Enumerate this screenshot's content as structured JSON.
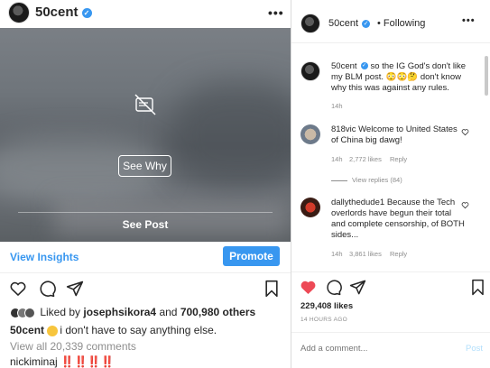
{
  "post": {
    "username": "50cent",
    "media": {
      "see_why_label": "See Why",
      "see_post_label": "See Post"
    },
    "view_insights_label": "View Insights",
    "promote_label": "Promote",
    "liked_prefix": "Liked by",
    "liked_user": "josephsikora4",
    "liked_and": "and",
    "liked_others": "700,980 others",
    "caption_user": "50cent",
    "caption_text": "i don't have to say anything else.",
    "view_all_comments": "View all 20,339 comments",
    "last_comment_user": "nickiminaj",
    "last_comment_text": "‼️‼️‼️‼️"
  },
  "detail": {
    "username": "50cent",
    "following_label": "• Following",
    "caption": {
      "user": "50cent",
      "text": "so the IG God's don't like my BLM post. 😳😳🤔 don't know why this was against any rules.",
      "time": "14h"
    },
    "comments": [
      {
        "user": "818vic",
        "text": "Welcome to United States of China big dawg!",
        "time": "14h",
        "likes": "2,772 likes",
        "reply_label": "Reply",
        "view_replies": "View replies (84)"
      },
      {
        "user": "dallythedude1",
        "text": "Because the Tech overlords have begun their total and complete censorship, of BOTH sides...",
        "time": "14h",
        "likes": "3,861 likes",
        "reply_label": "Reply"
      }
    ],
    "likes_count": "229,408 likes",
    "timestamp": "14 HOURS AGO",
    "add_comment_placeholder": "Add a comment...",
    "post_label": "Post"
  },
  "icons": {
    "hidden": "eye-slash-icon",
    "like": "heart-icon",
    "comment": "comment-icon",
    "share": "share-icon",
    "save": "bookmark-icon",
    "more": "more-icon",
    "verified": "verified-badge-icon"
  },
  "colors": {
    "link_blue": "#3897f0",
    "like_red": "#ed4956",
    "muted_gray": "#8e8e8e",
    "text": "#262626"
  }
}
